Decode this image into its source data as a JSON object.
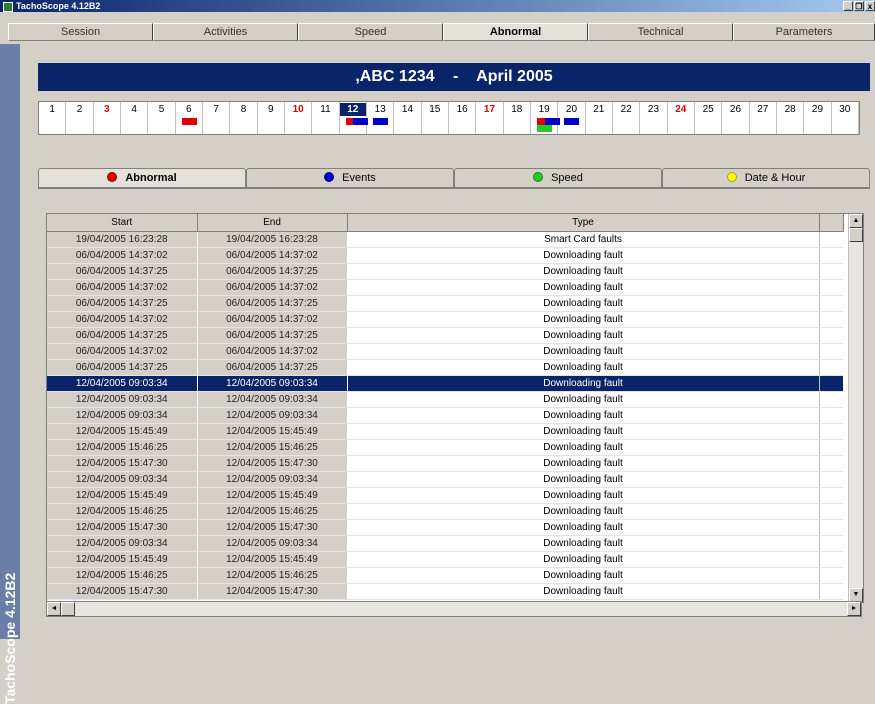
{
  "window": {
    "title": "TachoScope 4.12B2",
    "min_label": "_",
    "restore_label": "❐",
    "close_label": "x"
  },
  "top_tabs": [
    {
      "label": "Session"
    },
    {
      "label": "Activities"
    },
    {
      "label": "Speed"
    },
    {
      "label": "Abnormal"
    },
    {
      "label": "Technical"
    },
    {
      "label": "Parameters"
    }
  ],
  "side_label": "TachoScope 4.12B2",
  "banner": {
    "vehicle": ",ABC 1234",
    "separator": "-",
    "period": "April 2005"
  },
  "days": [
    "1",
    "2",
    "3",
    "4",
    "5",
    "6",
    "7",
    "8",
    "9",
    "10",
    "11",
    "12",
    "13",
    "14",
    "15",
    "16",
    "17",
    "18",
    "19",
    "20",
    "21",
    "22",
    "23",
    "24",
    "25",
    "26",
    "27",
    "28",
    "29",
    "30"
  ],
  "red_days": [
    3,
    10,
    17,
    24
  ],
  "selected_day": 12,
  "day_markers": [
    {
      "day": 6,
      "colors": [
        "#e00000"
      ]
    },
    {
      "day": 12,
      "colors": [
        "#e00000",
        "#0000cc"
      ]
    },
    {
      "day": 13,
      "colors": [
        "#0000cc"
      ]
    },
    {
      "day": 19,
      "colors": [
        "#e00000",
        "#0000cc",
        "#22cc22"
      ]
    },
    {
      "day": 20,
      "colors": [
        "#0000cc"
      ]
    }
  ],
  "sub_tabs": [
    {
      "label": "Abnormal",
      "color": "#e00000"
    },
    {
      "label": "Events",
      "color": "#0000cc"
    },
    {
      "label": "Speed",
      "color": "#22cc22"
    },
    {
      "label": "Date & Hour",
      "color": "#ffff00"
    }
  ],
  "table": {
    "headers": {
      "start": "Start",
      "end": "End",
      "type": "Type"
    },
    "selected_row": 9,
    "rows": [
      [
        "19/04/2005 16:23:28",
        "19/04/2005 16:23:28",
        "Smart Card faults"
      ],
      [
        "06/04/2005 14:37:02",
        "06/04/2005 14:37:02",
        "Downloading fault"
      ],
      [
        "06/04/2005 14:37:25",
        "06/04/2005 14:37:25",
        "Downloading fault"
      ],
      [
        "06/04/2005 14:37:02",
        "06/04/2005 14:37:02",
        "Downloading fault"
      ],
      [
        "06/04/2005 14:37:25",
        "06/04/2005 14:37:25",
        "Downloading fault"
      ],
      [
        "06/04/2005 14:37:02",
        "06/04/2005 14:37:02",
        "Downloading fault"
      ],
      [
        "06/04/2005 14:37:25",
        "06/04/2005 14:37:25",
        "Downloading fault"
      ],
      [
        "06/04/2005 14:37:02",
        "06/04/2005 14:37:02",
        "Downloading fault"
      ],
      [
        "06/04/2005 14:37:25",
        "06/04/2005 14:37:25",
        "Downloading fault"
      ],
      [
        "12/04/2005 09:03:34",
        "12/04/2005 09:03:34",
        "Downloading fault"
      ],
      [
        "12/04/2005 09:03:34",
        "12/04/2005 09:03:34",
        "Downloading fault"
      ],
      [
        "12/04/2005 09:03:34",
        "12/04/2005 09:03:34",
        "Downloading fault"
      ],
      [
        "12/04/2005 15:45:49",
        "12/04/2005 15:45:49",
        "Downloading fault"
      ],
      [
        "12/04/2005 15:46:25",
        "12/04/2005 15:46:25",
        "Downloading fault"
      ],
      [
        "12/04/2005 15:47:30",
        "12/04/2005 15:47:30",
        "Downloading fault"
      ],
      [
        "12/04/2005 09:03:34",
        "12/04/2005 09:03:34",
        "Downloading fault"
      ],
      [
        "12/04/2005 15:45:49",
        "12/04/2005 15:45:49",
        "Downloading fault"
      ],
      [
        "12/04/2005 15:46:25",
        "12/04/2005 15:46:25",
        "Downloading fault"
      ],
      [
        "12/04/2005 15:47:30",
        "12/04/2005 15:47:30",
        "Downloading fault"
      ],
      [
        "12/04/2005 09:03:34",
        "12/04/2005 09:03:34",
        "Downloading fault"
      ],
      [
        "12/04/2005 15:45:49",
        "12/04/2005 15:45:49",
        "Downloading fault"
      ],
      [
        "12/04/2005 15:46:25",
        "12/04/2005 15:46:25",
        "Downloading fault"
      ],
      [
        "12/04/2005 15:47:30",
        "12/04/2005 15:47:30",
        "Downloading fault"
      ]
    ]
  },
  "scroll_arrows": {
    "up": "▲",
    "down": "▼",
    "left": "◄",
    "right": "►"
  }
}
